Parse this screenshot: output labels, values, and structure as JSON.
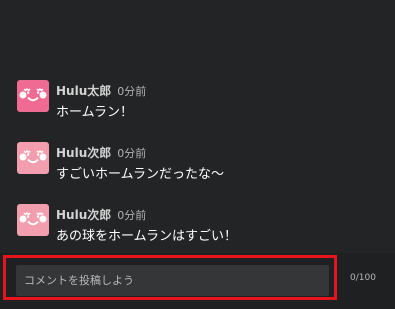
{
  "comments": [
    {
      "author": "Hulu太郎",
      "time": "0分前",
      "text": "ホームラン！",
      "avatar_icon": "smiley-face-icon"
    },
    {
      "author": "Hulu次郎",
      "time": "0分前",
      "text": "すごいホームランだったな〜",
      "avatar_icon": "smiley-face-icon"
    },
    {
      "author": "Hulu次郎",
      "time": "0分前",
      "text": "あの球をホームランはすごい！",
      "avatar_icon": "smiley-face-icon"
    }
  ],
  "input": {
    "placeholder": "コメントを投稿しよう",
    "value": "",
    "counter": "0/100"
  },
  "colors": {
    "background": "#232425",
    "avatar_pink": "#f06b93",
    "avatar_light_pink": "#f29eaf",
    "highlight_red": "#e8141b",
    "input_bg": "#353637"
  }
}
